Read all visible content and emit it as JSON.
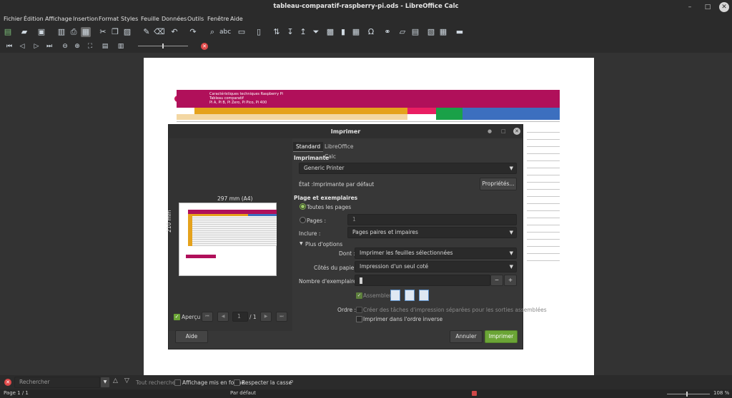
{
  "window": {
    "title": "tableau-comparatif-raspberry-pi.ods - LibreOffice Calc"
  },
  "menu": [
    "Fichier",
    "Édition",
    "Affichage",
    "Insertion",
    "Format",
    "Styles",
    "Feuille",
    "Données",
    "Outils",
    "Fenêtre",
    "Aide"
  ],
  "sheet_preview": {
    "banner_lines": [
      "Caractéristiques techniques Raspberry Pi",
      "Tableau comparatif",
      "Pi A, Pi B, Pi Zero, Pi Pico, Pi 400"
    ]
  },
  "dialog": {
    "title": "Imprimer",
    "tabs": [
      "Standard",
      "LibreOffice Calc"
    ],
    "preview": {
      "width_label": "297 mm (A4)",
      "height_label": "210 mm",
      "checkbox_label": "Aperçu",
      "page_value": "1",
      "page_total": "/ 1"
    },
    "printer": {
      "heading": "Imprimante",
      "selected": "Generic Printer",
      "state_label": "État :",
      "state_value": "Imprimante par défaut",
      "properties_button": "Propriétés..."
    },
    "range": {
      "heading": "Plage et exemplaires",
      "all_pages": "Toutes les pages",
      "pages": "Pages :",
      "pages_value": "1",
      "include_label": "Inclure :",
      "include_value": "Pages paires et impaires",
      "more_options": "Plus d'options",
      "dont_label": "Dont :",
      "dont_value": "Imprimer les feuilles sélectionnées",
      "sides_label": "Côtés du papier :",
      "sides_value": "Impression d'un seul coté",
      "copies_label": "Nombre d'exemplaires :",
      "copies_value": "1",
      "minus": "−",
      "plus": "+",
      "collate_label": "Assembler",
      "order_label": "Ordre :",
      "separate_jobs": "Créer des tâches d'impression séparées pour les sorties assemblées",
      "reverse_order": "Imprimer dans l'ordre inverse"
    },
    "buttons": {
      "help": "Aide",
      "cancel": "Annuler",
      "print": "Imprimer"
    }
  },
  "findbar": {
    "search_placeholder": "Rechercher",
    "find_all": "Tout rechercher",
    "formatted_display": "Affichage mis en forme",
    "match_case": "Respecter la casse"
  },
  "status": {
    "page": "Page 1 / 1",
    "page_style": "Par défaut",
    "zoom": "108 %"
  }
}
